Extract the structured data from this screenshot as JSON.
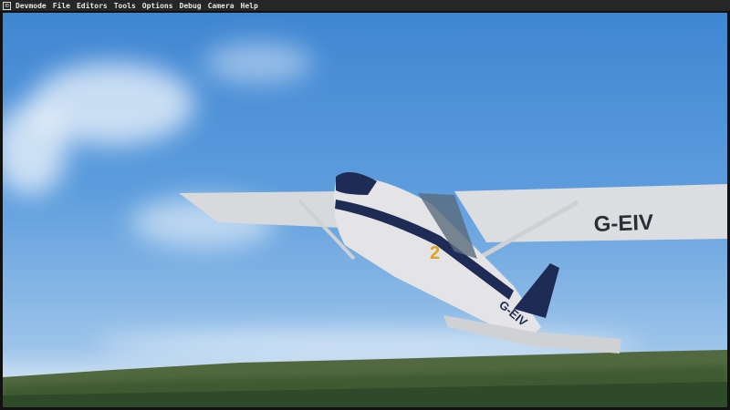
{
  "menubar": {
    "logo_icon": "devmode-logo-icon",
    "items": [
      "Devmode",
      "File",
      "Editors",
      "Tools",
      "Options",
      "Debug",
      "Camera",
      "Help"
    ]
  },
  "scene": {
    "wing_registration": "G-EIV",
    "tail_registration": "G-EIV",
    "fuselage_number": "2",
    "colors": {
      "sky": "#4a8fd8",
      "aircraft_body": "#e4e4e6",
      "stripe": "#1d2b55",
      "ground": "#3d5a32"
    }
  }
}
